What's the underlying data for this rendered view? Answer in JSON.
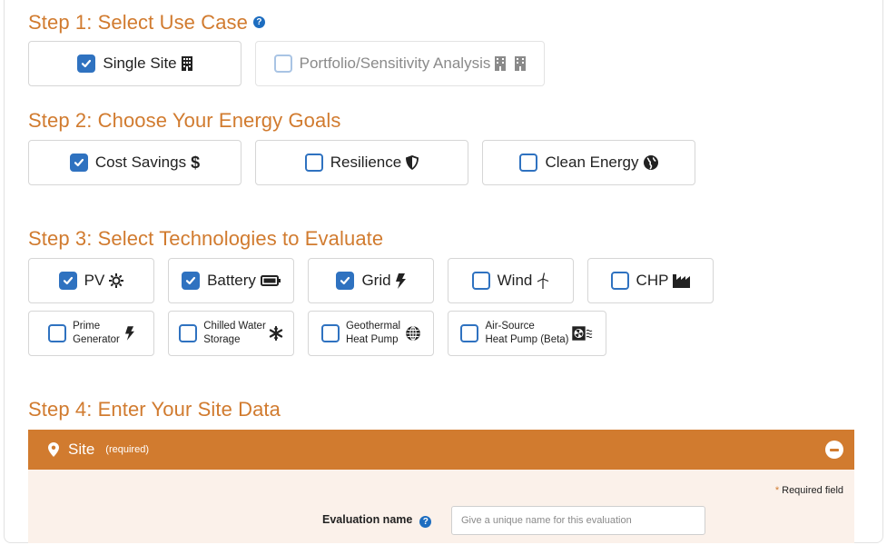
{
  "step1": {
    "title": "Step 1: Select Use Case",
    "help_glyph": "?",
    "options": [
      {
        "label": "Single Site",
        "checked": true,
        "icon": "building-icon"
      },
      {
        "label": "Portfolio/Sensitivity Analysis",
        "checked": false,
        "icon": "buildings-icon"
      }
    ]
  },
  "step2": {
    "title": "Step 2: Choose Your Energy Goals",
    "options": [
      {
        "label": "Cost Savings",
        "checked": true,
        "icon": "dollar-icon"
      },
      {
        "label": "Resilience",
        "checked": false,
        "icon": "shield-icon"
      },
      {
        "label": "Clean Energy",
        "checked": false,
        "icon": "globe-icon"
      }
    ]
  },
  "step3": {
    "title": "Step 3: Select Technologies to Evaluate",
    "row1": [
      {
        "label": "PV",
        "checked": true,
        "icon": "sun-icon"
      },
      {
        "label": "Battery",
        "checked": true,
        "icon": "battery-icon"
      },
      {
        "label": "Grid",
        "checked": true,
        "icon": "bolt-icon"
      },
      {
        "label": "Wind",
        "checked": false,
        "icon": "wind-turbine-icon"
      },
      {
        "label": "CHP",
        "checked": false,
        "icon": "industry-icon"
      }
    ],
    "row2": [
      {
        "line1": "Prime",
        "line2": "Generator",
        "checked": false,
        "icon": "bolt-icon"
      },
      {
        "line1": "Chilled Water",
        "line2": "Storage",
        "checked": false,
        "icon": "snowflake-icon"
      },
      {
        "line1": "Geothermal",
        "line2": "Heat Pump",
        "checked": false,
        "icon": "globe-grid-icon"
      },
      {
        "line1": "Air-Source",
        "line2": "Heat Pump (Beta)",
        "checked": false,
        "icon": "fan-icon"
      }
    ]
  },
  "step4": {
    "title": "Step 4: Enter Your Site Data",
    "panel": {
      "title": "Site",
      "required_tag": "(required)",
      "required_note_star": "*",
      "required_note": "Required field",
      "eval_label": "Evaluation name",
      "eval_help_glyph": "?",
      "eval_placeholder": "Give a unique name for this evaluation",
      "eval_value": ""
    }
  },
  "colors": {
    "accent_orange": "#d17b2f",
    "checkbox_blue": "#2f72c0",
    "panel_bg": "#fbf1ea"
  }
}
